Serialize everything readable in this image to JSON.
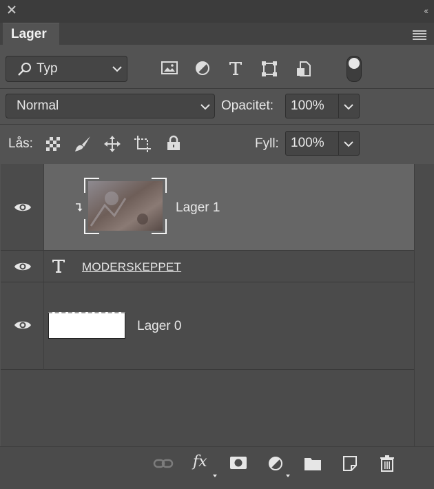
{
  "panel": {
    "tab_label": "Lager"
  },
  "filter": {
    "selected": "Typ"
  },
  "blend": {
    "mode": "Normal",
    "opacity_label": "Opacitet:",
    "opacity_value": "100%"
  },
  "lock": {
    "label": "Lås:",
    "fill_label": "Fyll:",
    "fill_value": "100%"
  },
  "layers": [
    {
      "name": "Lager 1",
      "selected": true,
      "clipped": true,
      "kind": "image"
    },
    {
      "name": "MODERSKEPPET",
      "selected": false,
      "kind": "text"
    },
    {
      "name": "Lager 0",
      "selected": false,
      "kind": "image-white"
    }
  ],
  "colors": {
    "panel": "#535353",
    "selected_row": "#666666",
    "layer_area": "#4b4b4b"
  },
  "icons": {
    "filters": [
      "image-filter-icon",
      "adjustment-filter-icon",
      "type-filter-icon",
      "shape-filter-icon",
      "smart-object-filter-icon"
    ],
    "locks": [
      "lock-transparent-pixels-icon",
      "lock-image-pixels-icon",
      "lock-position-icon",
      "lock-artboard-icon",
      "lock-all-icon"
    ],
    "footer": [
      "link-layers-icon",
      "fx-icon",
      "add-mask-icon",
      "new-adjustment-icon",
      "new-group-icon",
      "new-layer-icon",
      "delete-icon"
    ]
  }
}
